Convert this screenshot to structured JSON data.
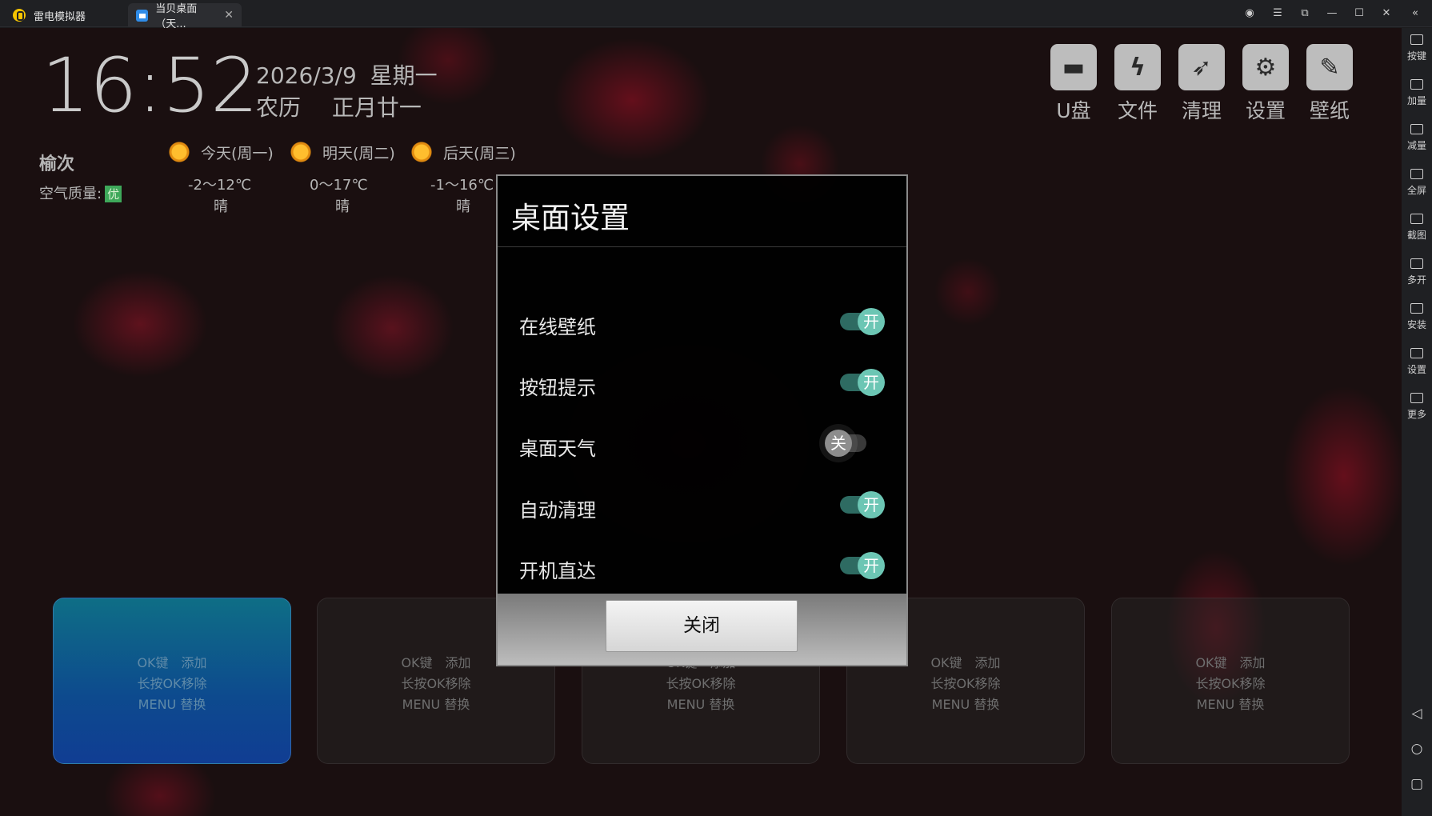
{
  "titlebar": {
    "app_tab": "雷电模拟器",
    "desktop_tab": "当贝桌面（天...",
    "tab_close": "✕",
    "controls": [
      "◉",
      "☰",
      "⧉",
      "—",
      "☐",
      "✕",
      "«"
    ]
  },
  "desktop": {
    "clock": "16:52",
    "date": "2026/3/9",
    "weekday": "星期一",
    "lunar_label": "农历",
    "lunar_date": "正月廿一",
    "city": "榆次",
    "air_quality_label": "空气质量:",
    "air_quality_value": "优",
    "weather": [
      {
        "day": "今天(周一)",
        "temp": "-2～12℃",
        "cond": "晴"
      },
      {
        "day": "明天(周二)",
        "temp": "0～17℃",
        "cond": "晴"
      },
      {
        "day": "后天(周三)",
        "temp": "-1～16℃",
        "cond": "晴"
      }
    ],
    "quick_actions": [
      {
        "label": "U盘",
        "icon": "usb-drive-icon"
      },
      {
        "label": "文件",
        "icon": "file-icon"
      },
      {
        "label": "清理",
        "icon": "rocket-clean-icon"
      },
      {
        "label": "设置",
        "icon": "gear-icon"
      },
      {
        "label": "壁纸",
        "icon": "wallpaper-icon"
      }
    ],
    "tiles": [
      {
        "line1": "OK键　添加",
        "line2": "长按OK移除",
        "line3": "MENU 替换"
      },
      {
        "line1": "OK键　添加",
        "line2": "长按OK移除",
        "line3": "MENU 替换"
      },
      {
        "line1": "OK键　添加",
        "line2": "长按OK移除",
        "line3": "MENU 替换"
      },
      {
        "line1": "OK键　添加",
        "line2": "长按OK移除",
        "line3": "MENU 替换"
      },
      {
        "line1": "OK键　添加",
        "line2": "长按OK移除",
        "line3": "MENU 替换"
      }
    ]
  },
  "dialog": {
    "title": "桌面设置",
    "settings": [
      {
        "label": "在线壁纸",
        "state": "开",
        "on": true
      },
      {
        "label": "按钮提示",
        "state": "开",
        "on": true
      },
      {
        "label": "桌面天气",
        "state": "关",
        "on": false
      },
      {
        "label": "自动清理",
        "state": "开",
        "on": true
      },
      {
        "label": "开机直达",
        "state": "开",
        "on": true
      }
    ],
    "close_label": "关闭"
  },
  "sidebar": {
    "items": [
      "按键",
      "加量",
      "减量",
      "全屏",
      "截图",
      "多开",
      "安装",
      "设置",
      "更多"
    ],
    "nav": [
      "◁",
      "○",
      "▢"
    ]
  },
  "colors": {
    "switch_on": "#6cc6b4",
    "active_tile_top": "#0e6e86",
    "active_tile_bottom": "#103d93",
    "air_quality_badge": "#3ea85a"
  }
}
